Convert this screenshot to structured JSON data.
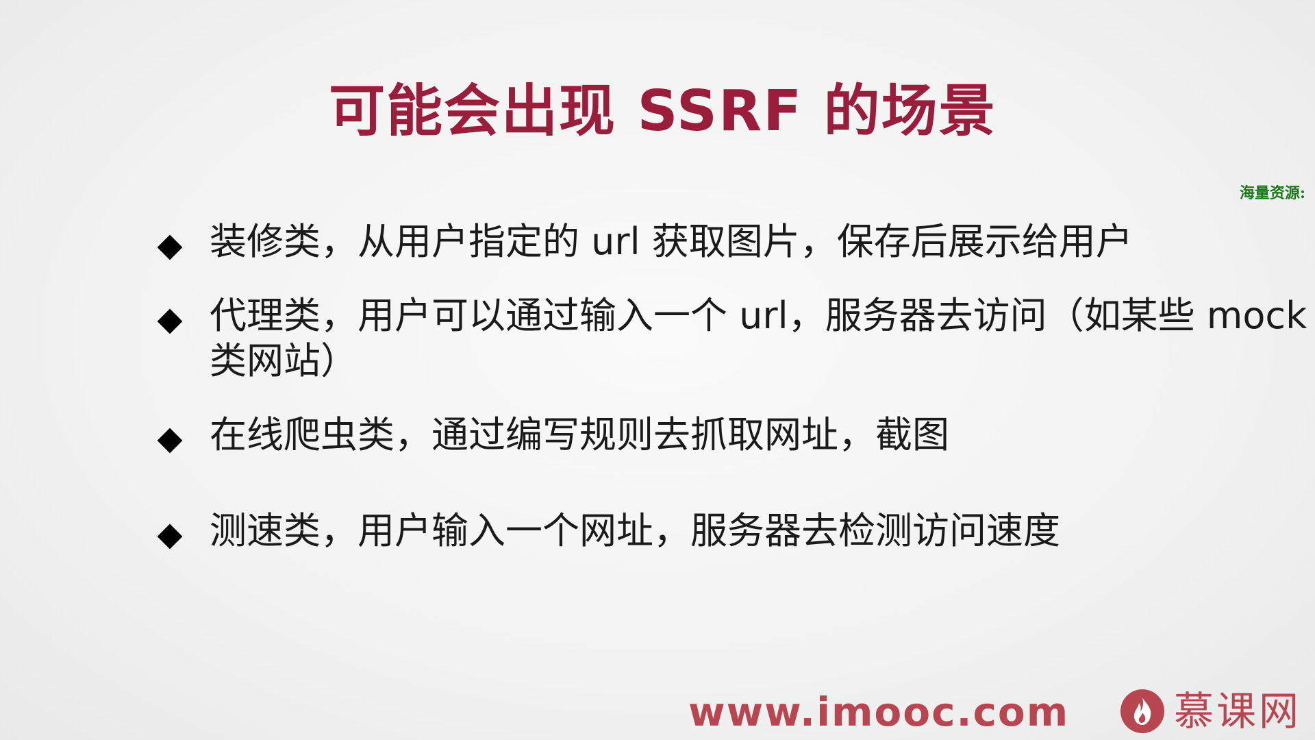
{
  "slide": {
    "title": "可能会出现 SSRF 的场景",
    "watermark": "海量资源:",
    "bullets": [
      {
        "line1": "装修类，从用户指定的 url 获取图片，保存后展示给用户",
        "line2": ""
      },
      {
        "line1": "代理类，用户可以通过输入一个 url，服务器去访问（如某些 mock",
        "line2": "类网站）"
      },
      {
        "line1": "在线爬虫类，通过编写规则去抓取网址，截图",
        "line2": ""
      },
      {
        "line1": "测速类，用户输入一个网址，服务器去检测访问速度",
        "line2": ""
      }
    ]
  },
  "footer": {
    "url": "www.imooc.com",
    "brand_name": "慕课网",
    "brand_icon": "flame-icon",
    "brand_color": "#b84650"
  },
  "colors": {
    "title": "#9a1d3b",
    "watermark": "#1c7a1c",
    "text": "#1a1a1a"
  }
}
